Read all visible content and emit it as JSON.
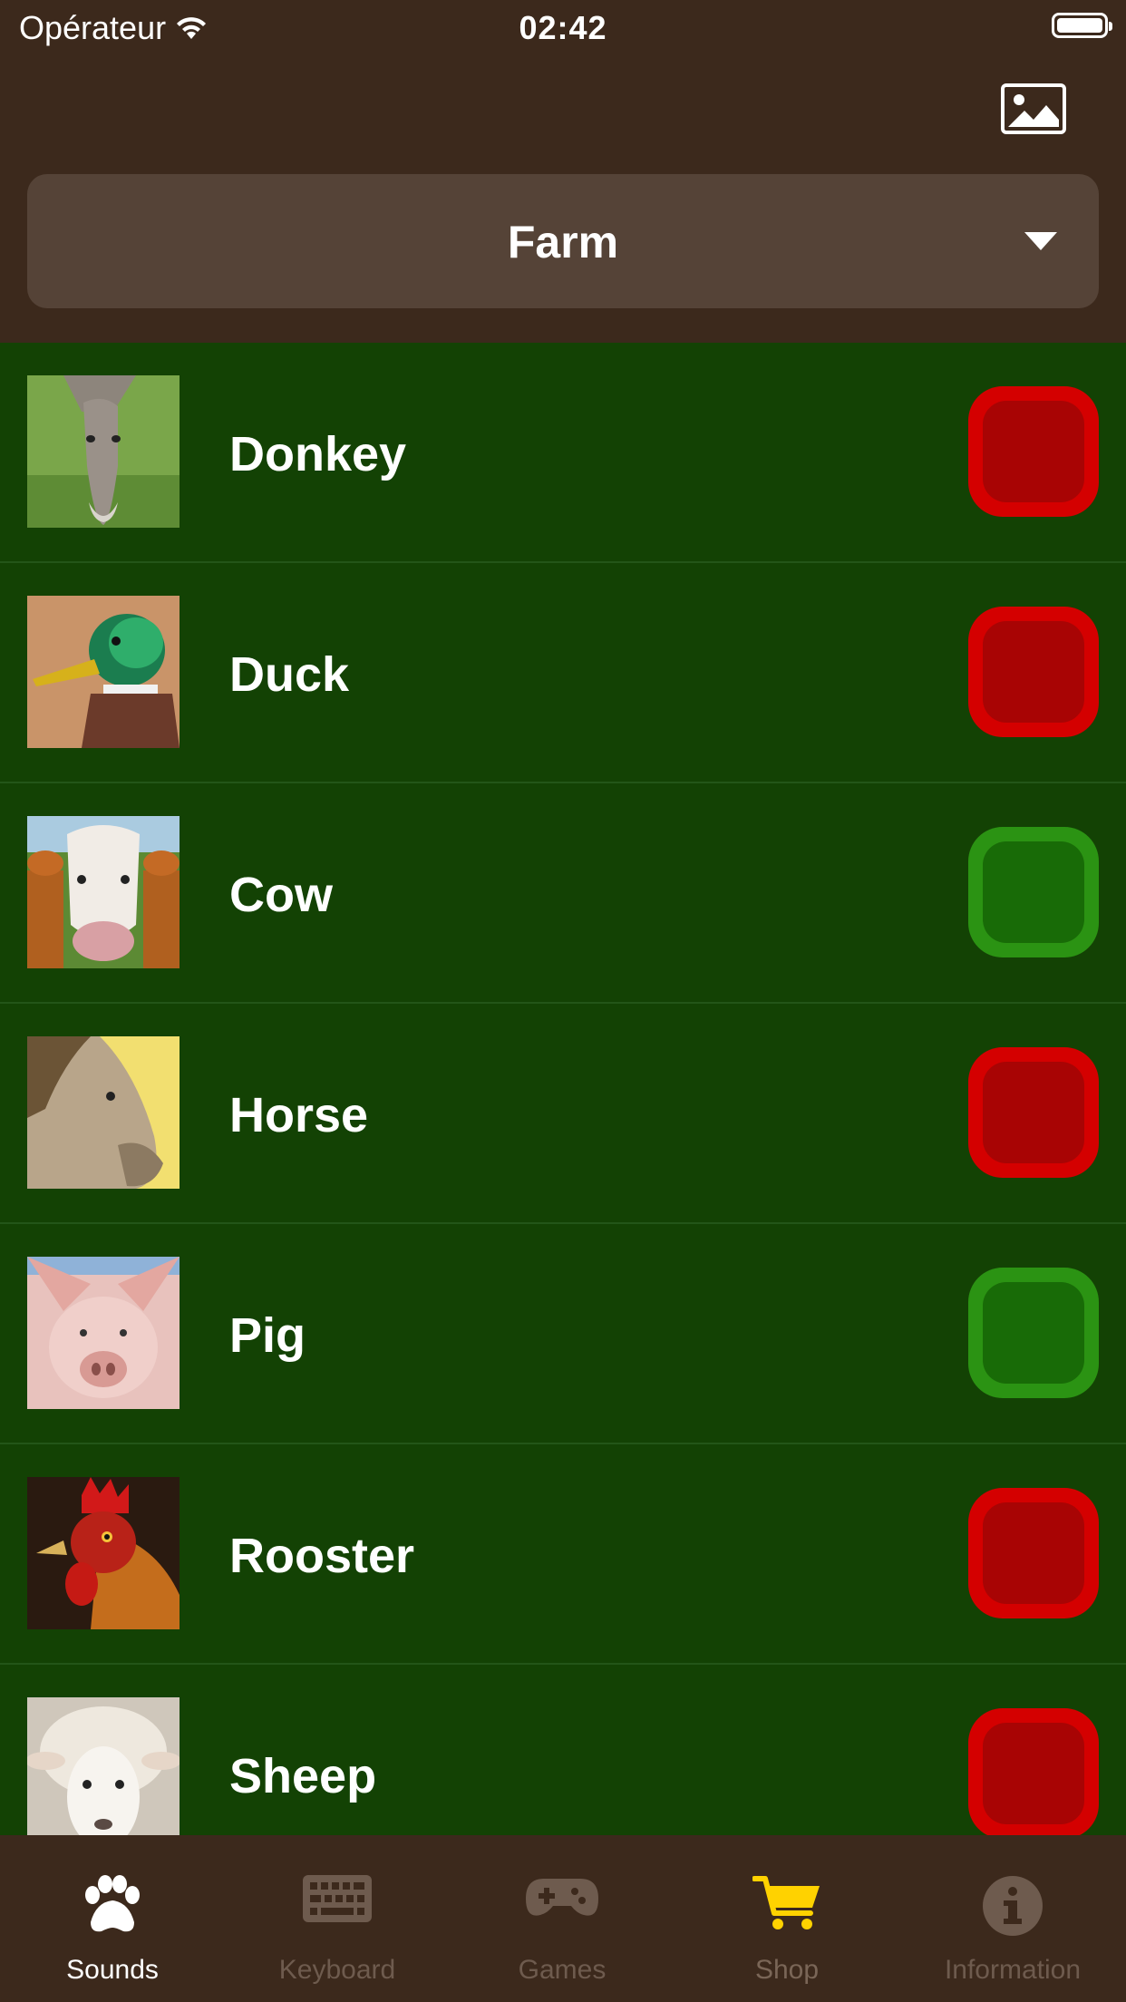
{
  "status_bar": {
    "carrier": "Opérateur",
    "time": "02:42",
    "wifi_icon": "wifi-icon",
    "battery_icon": "battery-icon"
  },
  "header": {
    "gallery_icon": "image-icon",
    "category": "Farm",
    "dropdown_icon": "caret-down-icon"
  },
  "animals": [
    {
      "label": "Donkey",
      "state": "off"
    },
    {
      "label": "Duck",
      "state": "off"
    },
    {
      "label": "Cow",
      "state": "on"
    },
    {
      "label": "Horse",
      "state": "off"
    },
    {
      "label": "Pig",
      "state": "on"
    },
    {
      "label": "Rooster",
      "state": "off"
    },
    {
      "label": "Sheep",
      "state": "off"
    }
  ],
  "tabs": [
    {
      "label": "Sounds",
      "icon": "paw-icon",
      "active": true
    },
    {
      "label": "Keyboard",
      "icon": "keyboard-icon",
      "active": false
    },
    {
      "label": "Games",
      "icon": "gamepad-icon",
      "active": false
    },
    {
      "label": "Shop",
      "icon": "cart-icon",
      "active": false
    },
    {
      "label": "Information",
      "icon": "info-icon",
      "active": false
    }
  ],
  "colors": {
    "background": "#3c291c",
    "list_background": "#134204",
    "toggle_off": "#d40000",
    "toggle_on": "#2b9313",
    "shop_accent": "#ffd200"
  }
}
